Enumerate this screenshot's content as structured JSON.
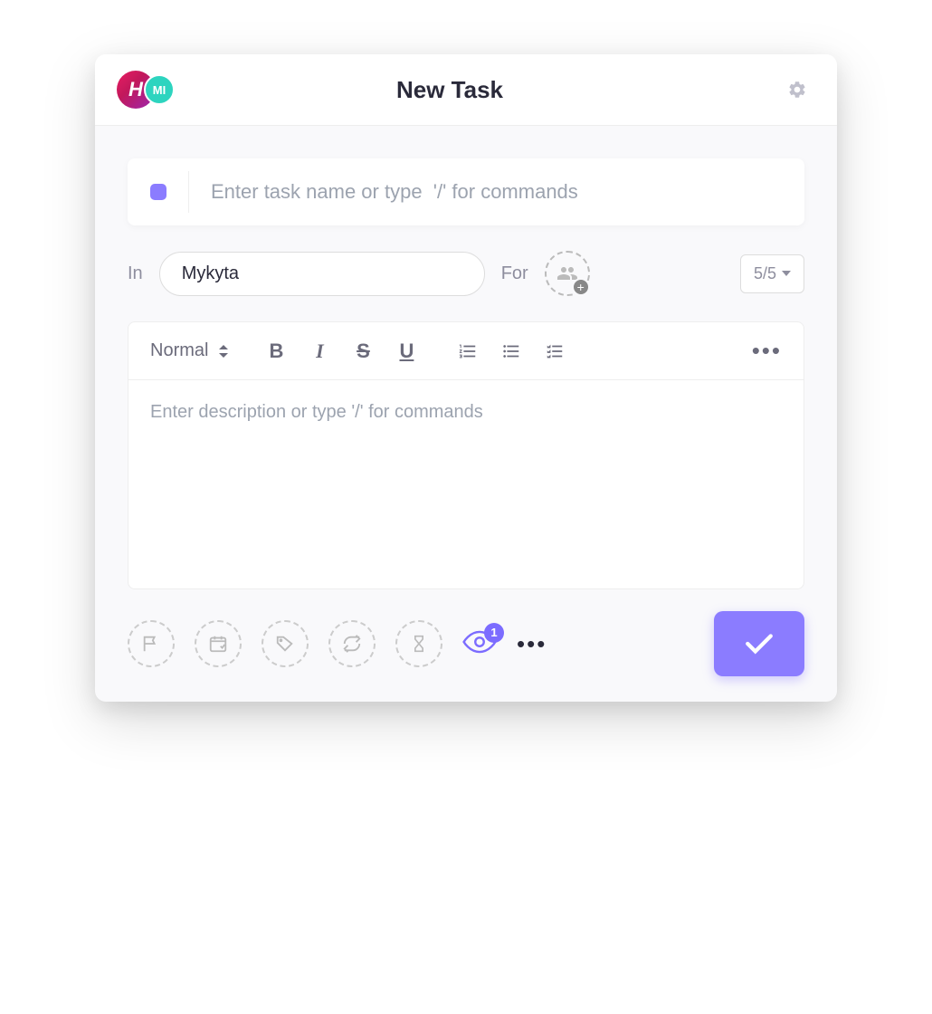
{
  "header": {
    "title": "New Task",
    "avatar1_glyph": "H",
    "avatar2_initials": "MI"
  },
  "task_name": {
    "placeholder": "Enter task name or type  '/' for commands",
    "value": ""
  },
  "location": {
    "label": "In",
    "value": "Mykyta"
  },
  "assignee": {
    "label": "For"
  },
  "priority": {
    "label": "5/5"
  },
  "editor": {
    "format_label": "Normal",
    "description_placeholder": "Enter description or type '/' for commands"
  },
  "watcher_count": "1",
  "icons": {
    "gear": "gear-icon",
    "status": "status-indicator",
    "people": "people-icon",
    "flag": "flag-icon",
    "calendar": "calendar-icon",
    "tag": "tag-icon",
    "recurring": "recurring-icon",
    "hourglass": "hourglass-icon",
    "eye": "eye-icon",
    "check": "check-icon"
  },
  "colors": {
    "accent": "#8b7cff",
    "avatar2_bg": "#2dd4bf"
  }
}
